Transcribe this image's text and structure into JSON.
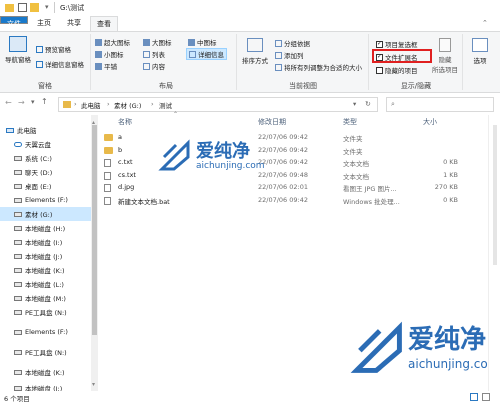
{
  "window": {
    "path_title": "G:\\测试"
  },
  "tabs": {
    "file": "文件",
    "home": "主页",
    "share": "共享",
    "view": "查看"
  },
  "ribbon": {
    "nav_pane": "导航窗格",
    "preview_pane": "预览窗格",
    "details_pane": "详细信息窗格",
    "group_panes": "窗格",
    "xl_icons": "超大图标",
    "large_icons": "大图标",
    "medium_icons": "中图标",
    "small_icons": "小图标",
    "list": "列表",
    "details": "详细信息",
    "tiles": "平铺",
    "content": "内容",
    "group_layout": "布局",
    "sort_by": "排序方式",
    "group_by": "分组依据",
    "add_column": "添加列",
    "fit_columns": "将所有列调整为合适的大小",
    "group_current_view": "当前视图",
    "item_checkboxes": "项目复选框",
    "file_ext": "文件扩展名",
    "hidden_items": "隐藏的项目",
    "hide_selected": "隐藏",
    "hide_selected2": "所选项目",
    "group_show_hide": "显示/隐藏",
    "options": "选项"
  },
  "breadcrumb": {
    "pc": "此电脑",
    "drive": "素材 (G:)",
    "folder": "测试"
  },
  "nav": [
    {
      "label": "此电脑",
      "kind": "pc"
    },
    {
      "label": "天翼云盘",
      "kind": "cloud"
    },
    {
      "label": "系统 (C:)",
      "kind": "drive"
    },
    {
      "label": "聊天 (D:)",
      "kind": "drive"
    },
    {
      "label": "桌面 (E:)",
      "kind": "drive"
    },
    {
      "label": "Elements (F:)",
      "kind": "drive"
    },
    {
      "label": "素材 (G:)",
      "kind": "drive",
      "selected": true
    },
    {
      "label": "本地磁盘 (H:)",
      "kind": "drive"
    },
    {
      "label": "本地磁盘 (I:)",
      "kind": "drive"
    },
    {
      "label": "本地磁盘 (J:)",
      "kind": "drive"
    },
    {
      "label": "本地磁盘 (K:)",
      "kind": "drive"
    },
    {
      "label": "本地磁盘 (L:)",
      "kind": "drive"
    },
    {
      "label": "本地磁盘 (M:)",
      "kind": "drive"
    },
    {
      "label": "PE工具盘 (N:)",
      "kind": "drive"
    },
    {
      "label": "Elements (F:)",
      "kind": "drive"
    },
    {
      "label": "PE工具盘 (N:)",
      "kind": "drive"
    },
    {
      "label": "本地磁盘 (K:)",
      "kind": "drive"
    },
    {
      "label": "本地磁盘 (I:)",
      "kind": "drive"
    }
  ],
  "columns": {
    "name": "名称",
    "date": "修改日期",
    "type": "类型",
    "size": "大小"
  },
  "files": [
    {
      "name": "a",
      "date": "22/07/06 09:42",
      "type": "文件夹",
      "size": "",
      "kind": "folder"
    },
    {
      "name": "b",
      "date": "22/07/06 09:42",
      "type": "文件夹",
      "size": "",
      "kind": "folder"
    },
    {
      "name": "c.txt",
      "date": "22/07/06 09:42",
      "type": "文本文档",
      "size": "0 KB",
      "kind": "file"
    },
    {
      "name": "cs.txt",
      "date": "22/07/06 09:48",
      "type": "文本文档",
      "size": "1 KB",
      "kind": "file"
    },
    {
      "name": "d.jpg",
      "date": "22/07/06 02:01",
      "type": "看图王 JPG 图片...",
      "size": "270 KB",
      "kind": "file"
    },
    {
      "name": "新建文本文档.bat",
      "date": "22/07/06 09:42",
      "type": "Windows 批处理...",
      "size": "0 KB",
      "kind": "file"
    }
  ],
  "watermark": {
    "brand": "爱纯净",
    "url": "aichunjing.com"
  },
  "status": {
    "count": "6 个项目"
  }
}
